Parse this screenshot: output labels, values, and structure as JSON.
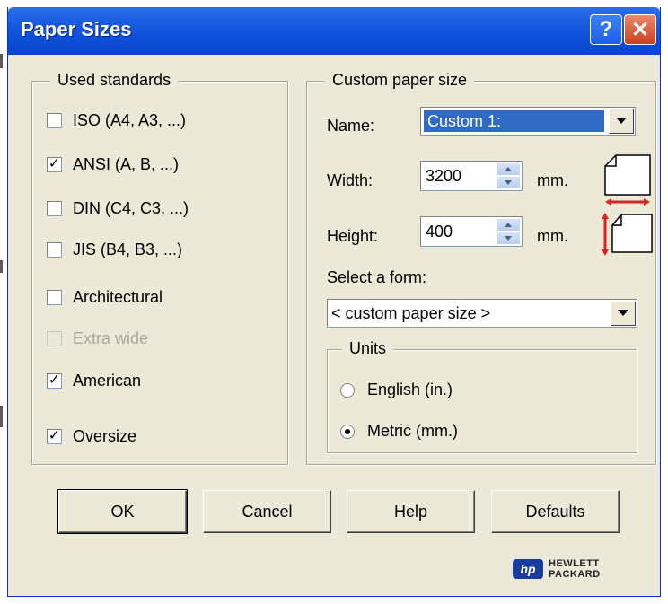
{
  "window": {
    "title": "Paper Sizes",
    "help_glyph": "?",
    "close_glyph": "✕"
  },
  "used_standards": {
    "legend": "Used standards",
    "items": [
      {
        "label": "ISO (A4, A3, ...)",
        "checked": false,
        "enabled": true
      },
      {
        "label": "ANSI (A, B, ...)",
        "checked": true,
        "enabled": true
      },
      {
        "label": "DIN (C4, C3, ...)",
        "checked": false,
        "enabled": true
      },
      {
        "label": "JIS (B4, B3, ...)",
        "checked": false,
        "enabled": true
      },
      {
        "label": "Architectural",
        "checked": false,
        "enabled": true
      },
      {
        "label": "Extra wide",
        "checked": false,
        "enabled": false
      },
      {
        "label": "American",
        "checked": true,
        "enabled": true
      },
      {
        "label": "Oversize",
        "checked": true,
        "enabled": true
      }
    ]
  },
  "custom_paper": {
    "legend": "Custom paper size",
    "name_label": "Name:",
    "name_value": "Custom 1:",
    "width_label": "Width:",
    "width_value": "3200",
    "height_label": "Height:",
    "height_value": "400",
    "unit": "mm.",
    "select_form_label": "Select a form:",
    "form_value": "< custom paper size >"
  },
  "units": {
    "legend": "Units",
    "options": [
      {
        "label": "English (in.)",
        "selected": false
      },
      {
        "label": "Metric (mm.)",
        "selected": true
      }
    ]
  },
  "buttons": {
    "ok": "OK",
    "cancel": "Cancel",
    "help": "Help",
    "defaults": "Defaults"
  },
  "brand": {
    "mark": "hp",
    "line1": "HEWLETT",
    "line2": "PACKARD"
  },
  "colors": {
    "titlebar": "#0a4ad4",
    "accent_red": "#e02020",
    "selection": "#316ac5"
  }
}
